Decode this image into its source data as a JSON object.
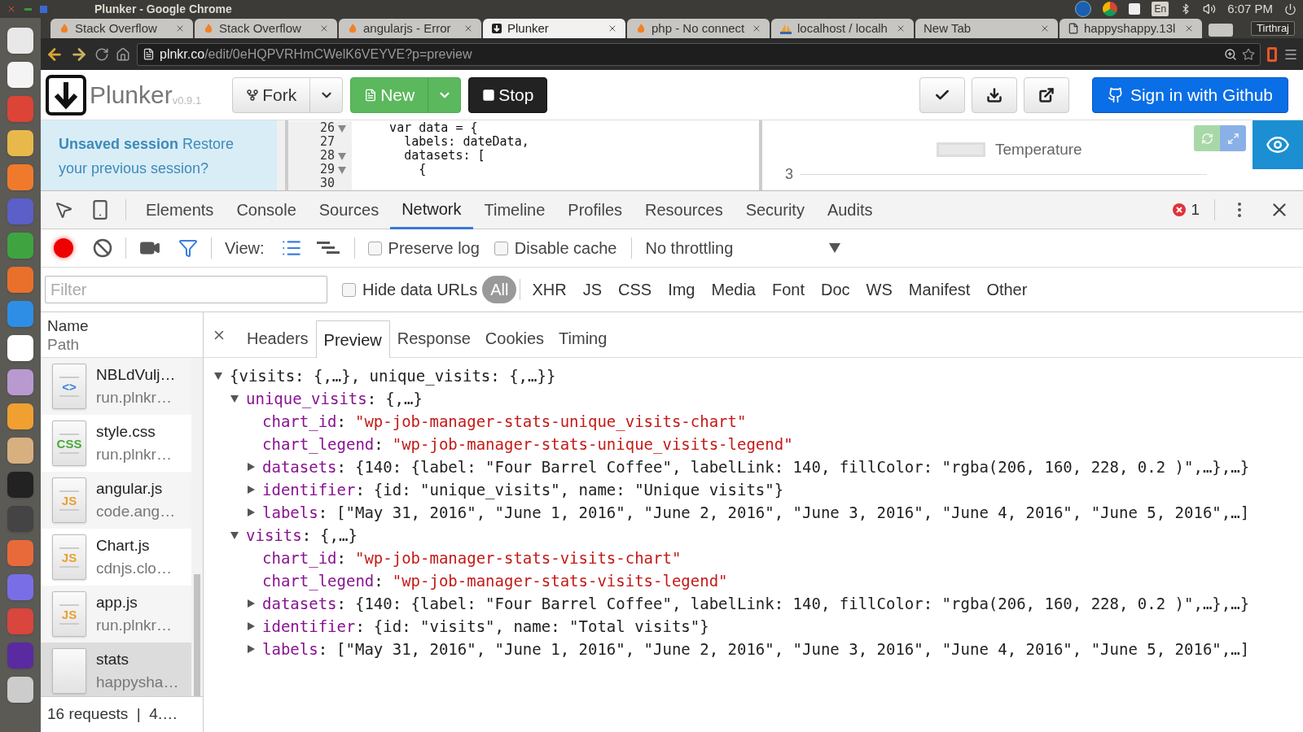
{
  "os_bar": {
    "title": "Plunker - Google Chrome",
    "keyboard_layout": "En",
    "clock": "6:07 PM"
  },
  "browser": {
    "tabs": [
      {
        "title": "Stack Overflow",
        "kind": "flame",
        "selected": false
      },
      {
        "title": "Stack Overflow",
        "kind": "flame",
        "selected": false
      },
      {
        "title": "angularjs - Error",
        "kind": "flame",
        "selected": false
      },
      {
        "title": "Plunker",
        "kind": "plunker",
        "selected": true
      },
      {
        "title": "php - No connect",
        "kind": "flame",
        "selected": false
      },
      {
        "title": "localhost / localh",
        "kind": "pma",
        "selected": false
      },
      {
        "title": "New Tab",
        "kind": "none",
        "selected": false
      },
      {
        "title": "happyshappy.13l",
        "kind": "file",
        "selected": false
      }
    ],
    "profile": "Tirthraj",
    "url_host": "plnkr.co",
    "url_path": "/edit/0eHQPVRHmCWelK6VEYVE?p=preview"
  },
  "plunker": {
    "logo_text": "Plunker",
    "version": "v0.9.1",
    "buttons": [
      {
        "label": "Fork",
        "kind": "fork"
      },
      {
        "label": "New",
        "kind": "new"
      },
      {
        "label": "Stop",
        "kind": "stop"
      }
    ],
    "sign_in": "Sign in with Github",
    "session_notice": "**Unsaved session** Restore your previous session?",
    "code_lines": [
      {
        "number": "26",
        "fold": true,
        "code": "    var data = {"
      },
      {
        "number": "27",
        "fold": false,
        "code": "      labels: dateData,"
      },
      {
        "number": "28",
        "fold": true,
        "code": "      datasets: ["
      },
      {
        "number": "29",
        "fold": true,
        "code": "        {"
      },
      {
        "number": "30",
        "fold": false
      }
    ],
    "preview": {
      "legend": "Temperature",
      "y_tick": "3"
    }
  },
  "devtools": {
    "tabs": [
      {
        "label": "Elements",
        "selected": false
      },
      {
        "label": "Console",
        "selected": false
      },
      {
        "label": "Sources",
        "selected": false
      },
      {
        "label": "Network",
        "selected": true
      },
      {
        "label": "Timeline",
        "selected": false
      },
      {
        "label": "Profiles",
        "selected": false
      },
      {
        "label": "Resources",
        "selected": false
      },
      {
        "label": "Security",
        "selected": false
      },
      {
        "label": "Audits",
        "selected": false
      }
    ],
    "error_count": "1",
    "recording": true,
    "filter_open": true,
    "view_label": "View:",
    "large_rows": true,
    "checkboxes": [
      {
        "label": "Preserve log",
        "checked": false
      },
      {
        "label": "Disable cache",
        "checked": false
      }
    ],
    "throttling": "No throttling",
    "filter": {
      "placeholder": "Filter"
    },
    "hide_data_urls": {
      "label": "Hide data URLs",
      "checked": false
    },
    "types": [
      {
        "label": "All",
        "selected": true
      },
      {
        "label": "XHR",
        "selected": false
      },
      {
        "label": "JS",
        "selected": false
      },
      {
        "label": "CSS",
        "selected": false
      },
      {
        "label": "Img",
        "selected": false
      },
      {
        "label": "Media",
        "selected": false
      },
      {
        "label": "Font",
        "selected": false
      },
      {
        "label": "Doc",
        "selected": false
      },
      {
        "label": "WS",
        "selected": false
      },
      {
        "label": "Manifest",
        "selected": false
      },
      {
        "label": "Other",
        "selected": false
      }
    ],
    "list_header": {
      "name": "Name",
      "path": "Path"
    },
    "requests": [
      {
        "name": "NBLdVulj…",
        "path": "run.plnkr…",
        "kind": "html",
        "badge": "<>",
        "selected": false
      },
      {
        "name": "style.css",
        "path": "run.plnkr…",
        "kind": "css",
        "badge": "CSS",
        "selected": false
      },
      {
        "name": "angular.js",
        "path": "code.ang…",
        "kind": "js",
        "badge": "JS",
        "selected": false
      },
      {
        "name": "Chart.js",
        "path": "cdnjs.clo…",
        "kind": "js",
        "badge": "JS",
        "selected": false
      },
      {
        "name": "app.js",
        "path": "run.plnkr…",
        "kind": "js",
        "badge": "JS",
        "selected": false
      },
      {
        "name": "stats",
        "path": "happysha…",
        "kind": "blank",
        "selected": true
      }
    ],
    "summary": "16 requests  |  4.…",
    "detail_tabs": [
      {
        "label": "Headers",
        "selected": false
      },
      {
        "label": "Preview",
        "selected": true
      },
      {
        "label": "Response",
        "selected": false
      },
      {
        "label": "Cookies",
        "selected": false
      },
      {
        "label": "Timing",
        "selected": false
      }
    ],
    "preview_tree": {
      "kind": "expandable",
      "expanded": true,
      "value": "{visits: {,…}, unique_visits: {,…}}",
      "children": [
        {
          "kind": "expandable",
          "expanded": true,
          "key": "unique_visits:",
          "value": "{,…}",
          "children": [
            {
              "kind": "leaf",
              "key": "chart_id:",
              "value": "\"wp-job-manager-stats-unique_visits-chart\""
            },
            {
              "kind": "leaf",
              "key": "chart_legend:",
              "value": "\"wp-job-manager-stats-unique_visits-legend\""
            },
            {
              "kind": "expandable",
              "expanded": false,
              "key": "datasets:",
              "value": "{140: {label: \"Four Barrel Coffee\", labelLink: 140, fillColor: \"rgba(206, 160, 228, 0.2 )\",…},…}"
            },
            {
              "kind": "expandable",
              "expanded": false,
              "key": "identifier:",
              "value": "{id: \"unique_visits\", name: \"Unique visits\"}"
            },
            {
              "kind": "expandable",
              "expanded": false,
              "key": "labels:",
              "value": "[\"May 31, 2016\", \"June 1, 2016\", \"June 2, 2016\", \"June 3, 2016\", \"June 4, 2016\", \"June 5, 2016\",…]"
            }
          ]
        },
        {
          "kind": "expandable",
          "expanded": true,
          "key": "visits:",
          "value": "{,…}",
          "children": [
            {
              "kind": "leaf",
              "key": "chart_id:",
              "value": "\"wp-job-manager-stats-visits-chart\""
            },
            {
              "kind": "leaf",
              "key": "chart_legend:",
              "value": "\"wp-job-manager-stats-visits-legend\""
            },
            {
              "kind": "expandable",
              "expanded": false,
              "key": "datasets:",
              "value": "{140: {label: \"Four Barrel Coffee\", labelLink: 140, fillColor: \"rgba(206, 160, 228, 0.2 )\",…},…}"
            },
            {
              "kind": "expandable",
              "expanded": false,
              "key": "identifier:",
              "value": "{id: \"visits\", name: \"Total visits\"}"
            },
            {
              "kind": "expandable",
              "expanded": false,
              "key": "labels:",
              "value": "[\"May 31, 2016\", \"June 1, 2016\", \"June 2, 2016\", \"June 3, 2016\", \"June 4, 2016\", \"June 5, 2016\",…]"
            }
          ]
        }
      ]
    }
  }
}
